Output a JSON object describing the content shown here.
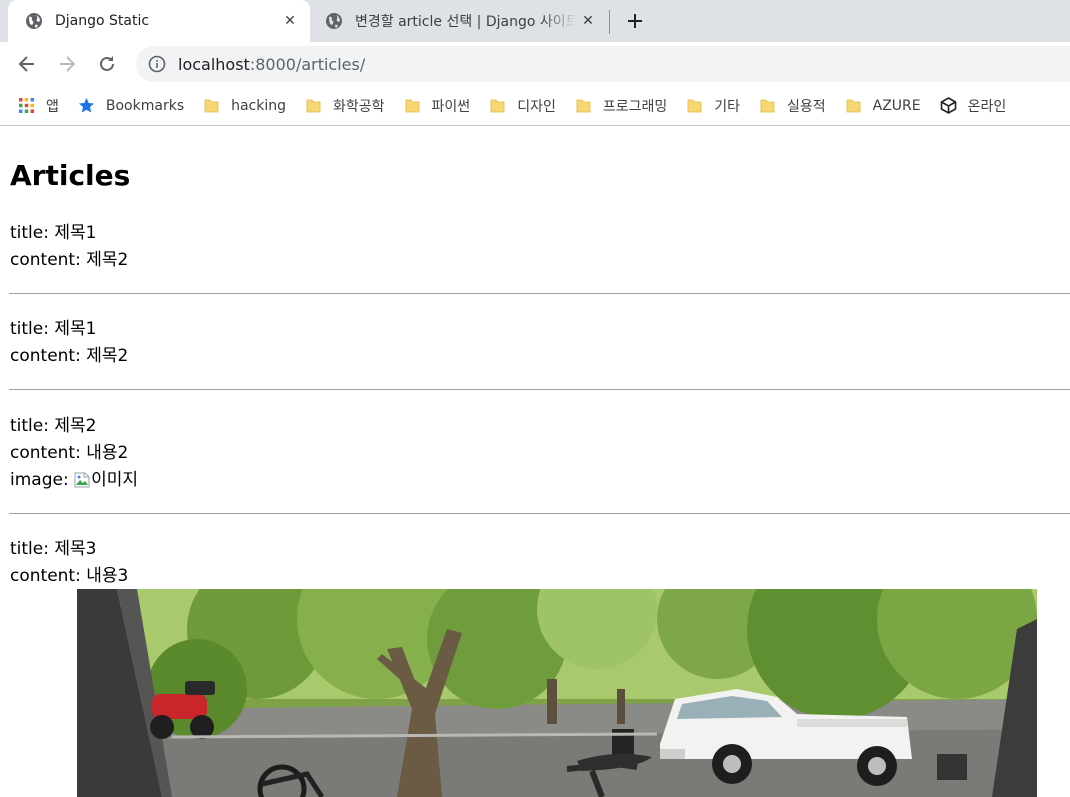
{
  "browser": {
    "tabs": [
      {
        "title": "Django Static",
        "active": true
      },
      {
        "title": "변경할 article 선택 | Django 사이트 관리",
        "active": false
      }
    ],
    "address": {
      "host": "localhost",
      "path": ":8000/articles/"
    },
    "bookmarks": [
      {
        "label": "앱",
        "icon": "apps-grid-icon"
      },
      {
        "label": "Bookmarks",
        "icon": "star-icon"
      },
      {
        "label": "hacking",
        "icon": "folder-icon"
      },
      {
        "label": "화학공학",
        "icon": "folder-icon"
      },
      {
        "label": "파이썬",
        "icon": "folder-icon"
      },
      {
        "label": "디자인",
        "icon": "folder-icon"
      },
      {
        "label": "프로그래밍",
        "icon": "folder-icon"
      },
      {
        "label": "기타",
        "icon": "folder-icon"
      },
      {
        "label": "실용적",
        "icon": "folder-icon"
      },
      {
        "label": "AZURE",
        "icon": "folder-icon"
      },
      {
        "label": "온라인",
        "icon": "cube-icon"
      }
    ]
  },
  "page": {
    "heading": "Articles",
    "title_label": "title: ",
    "content_label": "content: ",
    "image_label": "image: ",
    "articles": [
      {
        "title": "제목1",
        "content": "제목2"
      },
      {
        "title": "제목1",
        "content": "제목2"
      },
      {
        "title": "제목2",
        "content": "내용2",
        "image_alt": "이미지"
      },
      {
        "title": "제목3",
        "content": "내용3"
      }
    ]
  },
  "colors": {
    "tabstrip": "#dee1e6",
    "omnibox": "#f1f3f4",
    "folder": "#f7d774",
    "star": "#1a73e8"
  }
}
